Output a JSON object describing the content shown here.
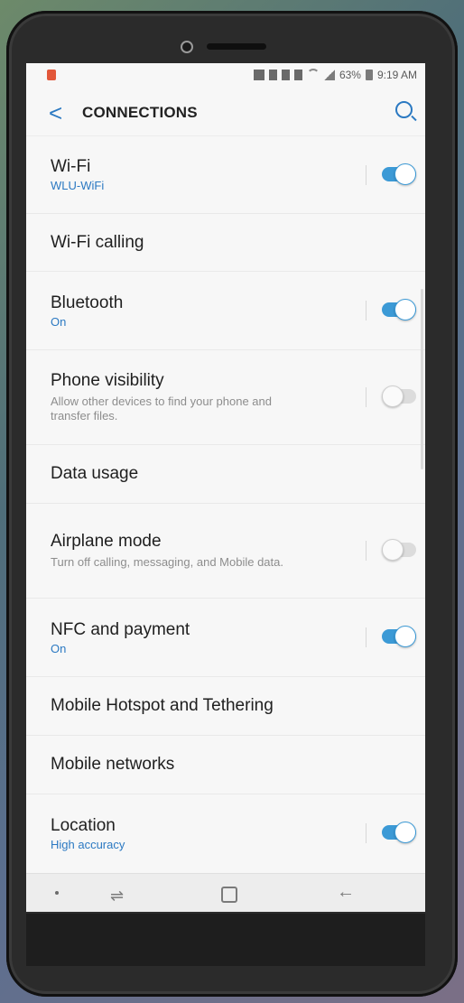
{
  "status": {
    "battery": "63%",
    "time": "9:19 AM"
  },
  "header": {
    "back": "<",
    "title": "CONNECTIONS"
  },
  "items": [
    {
      "title": "Wi-Fi",
      "subtitle": "WLU-WiFi",
      "toggle": true
    },
    {
      "title": "Wi-Fi calling"
    },
    {
      "title": "Bluetooth",
      "subtitle": "On",
      "toggle": true
    },
    {
      "title": "Phone visibility",
      "description": "Allow other devices to find your phone and transfer files.",
      "toggle": false
    },
    {
      "title": "Data usage"
    },
    {
      "title": "Airplane mode",
      "description": "Turn off calling, messaging, and Mobile data.",
      "toggle": false
    },
    {
      "title": "NFC and payment",
      "subtitle": "On",
      "toggle": true
    },
    {
      "title": "Mobile Hotspot and Tethering"
    },
    {
      "title": "Mobile networks"
    },
    {
      "title": "Location",
      "subtitle": "High accuracy",
      "toggle": true
    }
  ],
  "navbar": {
    "recent_glyph": "⇌",
    "back_glyph": "←"
  },
  "colors": {
    "accent": "#2b79c2",
    "toggle_on": "#3c9ad6"
  }
}
